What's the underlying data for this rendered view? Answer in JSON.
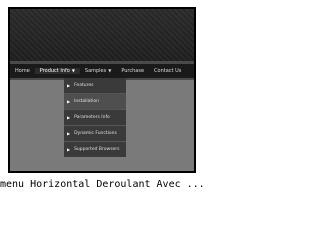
{
  "menu": {
    "items": [
      {
        "label": "Home"
      },
      {
        "label": "Product Info",
        "has_submenu": true
      },
      {
        "label": "Samples",
        "has_submenu": true
      },
      {
        "label": "Purchase"
      },
      {
        "label": "Contact Us"
      }
    ]
  },
  "dropdown": {
    "items": [
      {
        "label": "Features"
      },
      {
        "label": "Installation"
      },
      {
        "label": "Parameters Info"
      },
      {
        "label": "Dynamic Functions"
      },
      {
        "label": "Supported Browsers"
      }
    ]
  },
  "caption": "menu Horizontal Deroulant Avec ...",
  "colors": {
    "frame": "#000000",
    "menubar": "#1a1a1a",
    "dropdown": "#3a3a3a",
    "panel": "#7a7a7a"
  }
}
